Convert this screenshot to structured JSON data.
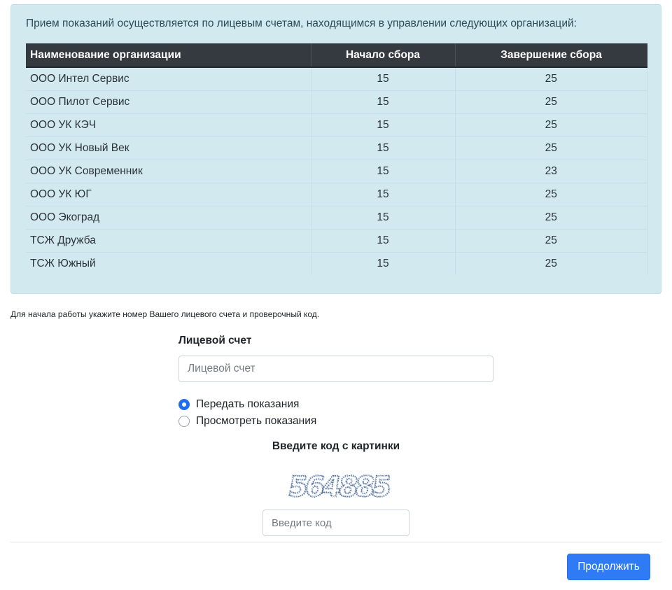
{
  "info": {
    "text": "Прием показаний осуществляется по лицевым счетам, находящимся в управлении следующих организаций:",
    "columns": [
      "Наименование организации",
      "Начало сбора",
      "Завершение сбора"
    ],
    "rows": [
      {
        "name": "ООО Интел Сервис",
        "start": "15",
        "end": "25"
      },
      {
        "name": "ООО Пилот Сервис",
        "start": "15",
        "end": "25"
      },
      {
        "name": "ООО УК КЭЧ",
        "start": "15",
        "end": "25"
      },
      {
        "name": "ООО УК Новый Век",
        "start": "15",
        "end": "25"
      },
      {
        "name": "ООО УК Современник",
        "start": "15",
        "end": "23"
      },
      {
        "name": "ООО УК ЮГ",
        "start": "15",
        "end": "25"
      },
      {
        "name": "ООО Экоград",
        "start": "15",
        "end": "25"
      },
      {
        "name": "ТСЖ Дружба",
        "start": "15",
        "end": "25"
      },
      {
        "name": "ТСЖ Южный",
        "start": "15",
        "end": "25"
      }
    ]
  },
  "hint": "Для начала работы укажите номер Вашего лицевого счета и проверочный код.",
  "form": {
    "account_label": "Лицевой счет",
    "account_placeholder": "Лицевой счет",
    "account_value": "",
    "radio_options": [
      {
        "label": "Передать показания",
        "checked": true
      },
      {
        "label": "Просмотреть показания",
        "checked": false
      }
    ],
    "captcha_title": "Введите код с картинки",
    "captcha_code": "564885",
    "code_placeholder": "Введите код",
    "code_value": "",
    "submit_label": "Продолжить"
  },
  "colors": {
    "info_background": "#d1e9ef",
    "table_header": "#343a40",
    "primary": "#2f7bf5",
    "captcha_ink": "#4d6d9a"
  }
}
